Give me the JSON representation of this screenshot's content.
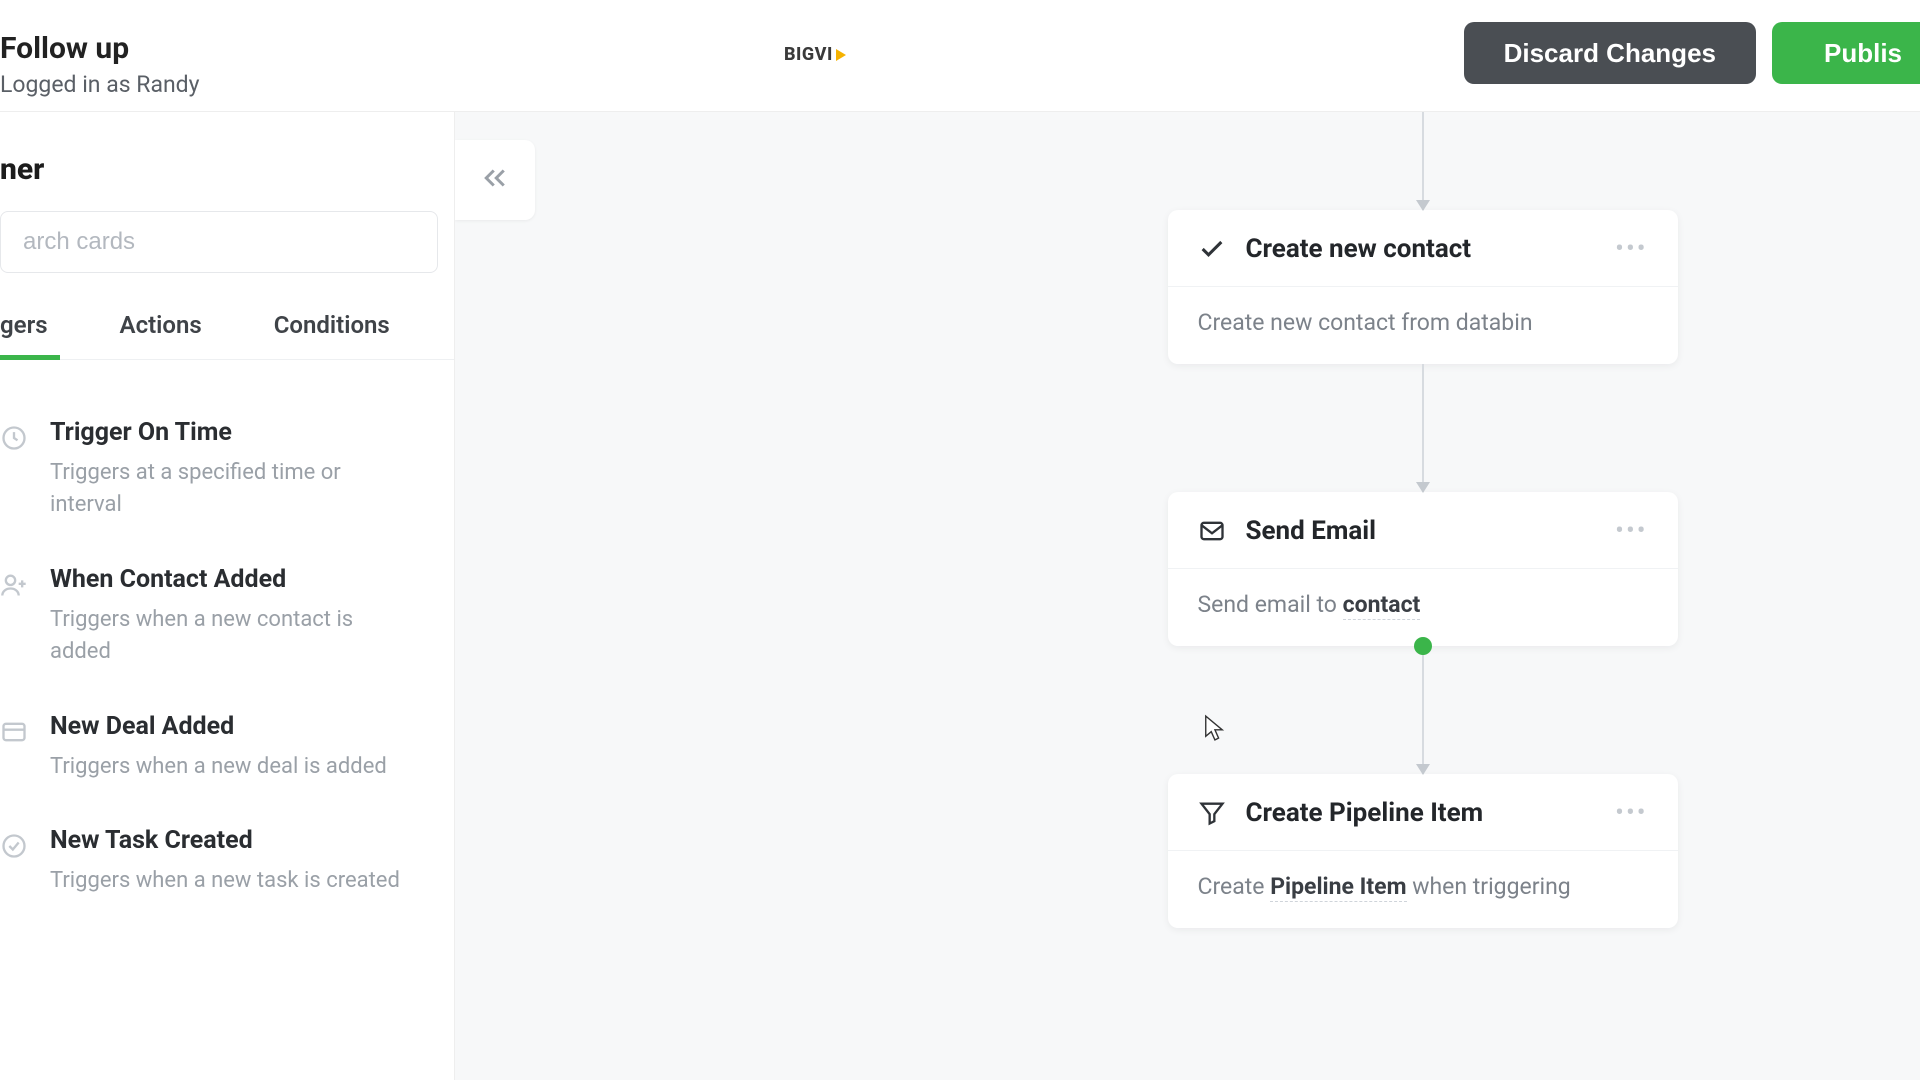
{
  "header": {
    "title": "Follow up",
    "logged_in_as": "Logged in as Randy",
    "logo_text": "BIGVI",
    "discard_label": "Discard Changes",
    "publish_label": "Publis"
  },
  "sidebar": {
    "panel_title": "ner",
    "search_placeholder": "arch cards",
    "tabs": [
      {
        "label": "gers",
        "active": true
      },
      {
        "label": "Actions",
        "active": false
      },
      {
        "label": "Conditions",
        "active": false
      }
    ],
    "cards": [
      {
        "icon": "clock-icon",
        "title": "Trigger On Time",
        "desc": "Triggers at a specified time or interval"
      },
      {
        "icon": "user-plus-icon",
        "title": "When Contact Added",
        "desc": "Triggers when a new contact is added"
      },
      {
        "icon": "deal-icon",
        "title": "New Deal Added",
        "desc": "Triggers when a new deal is added"
      },
      {
        "icon": "check-circle-icon",
        "title": "New Task Created",
        "desc": "Triggers when a new task is created"
      }
    ]
  },
  "canvas": {
    "collapse_aria": "Collapse sidebar",
    "nodes": [
      {
        "icon": "check-icon",
        "title": "Create new contact",
        "body_prefix": "Create new contact from databin",
        "body_chip": "",
        "body_suffix": ""
      },
      {
        "icon": "mail-icon",
        "title": "Send Email",
        "body_prefix": "Send email to ",
        "body_chip": "contact",
        "body_suffix": ""
      },
      {
        "icon": "funnel-icon",
        "title": "Create Pipeline Item",
        "body_prefix": "Create ",
        "body_chip": "Pipeline Item",
        "body_suffix": " when triggering"
      }
    ]
  }
}
